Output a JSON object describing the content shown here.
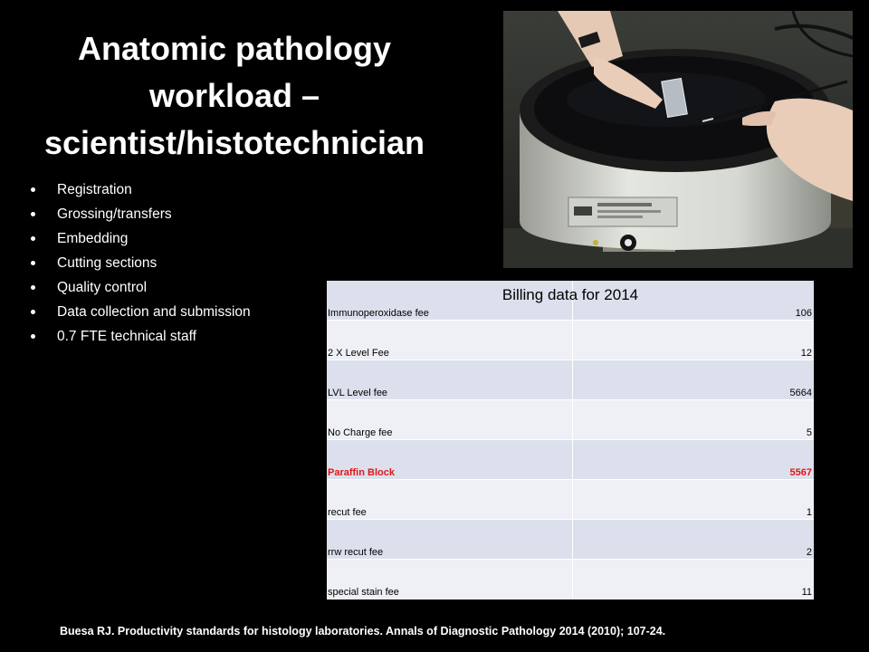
{
  "slide": {
    "title_lines": [
      "Anatomic pathology",
      "workload –",
      "scientist/histotechnician"
    ],
    "bullets": [
      "Registration",
      "Grossing/transfers",
      "Embedding",
      "Cutting sections",
      "Quality control",
      "Data collection and submission",
      "0.7  FTE technical staff"
    ],
    "citation": "Buesa RJ. Productivity standards for histology laboratories. Annals of Diagnostic Pathology 2014 (2010); 107-24."
  },
  "billing_table": {
    "title": "Billing data for 2014",
    "highlight_color": "#e01818",
    "rows": [
      {
        "name": "Immunoperoxidase fee",
        "value": "106"
      },
      {
        "name": "2 X Level Fee",
        "value": "12"
      },
      {
        "name": "LVL Level fee",
        "value": "5664"
      },
      {
        "name": "No Charge fee",
        "value": "5"
      },
      {
        "name": "Paraffin Block",
        "value": "5567"
      },
      {
        "name": "recut fee",
        "value": "1"
      },
      {
        "name": "rrw recut fee",
        "value": "2"
      },
      {
        "name": "special stain fee",
        "value": "11"
      }
    ]
  }
}
